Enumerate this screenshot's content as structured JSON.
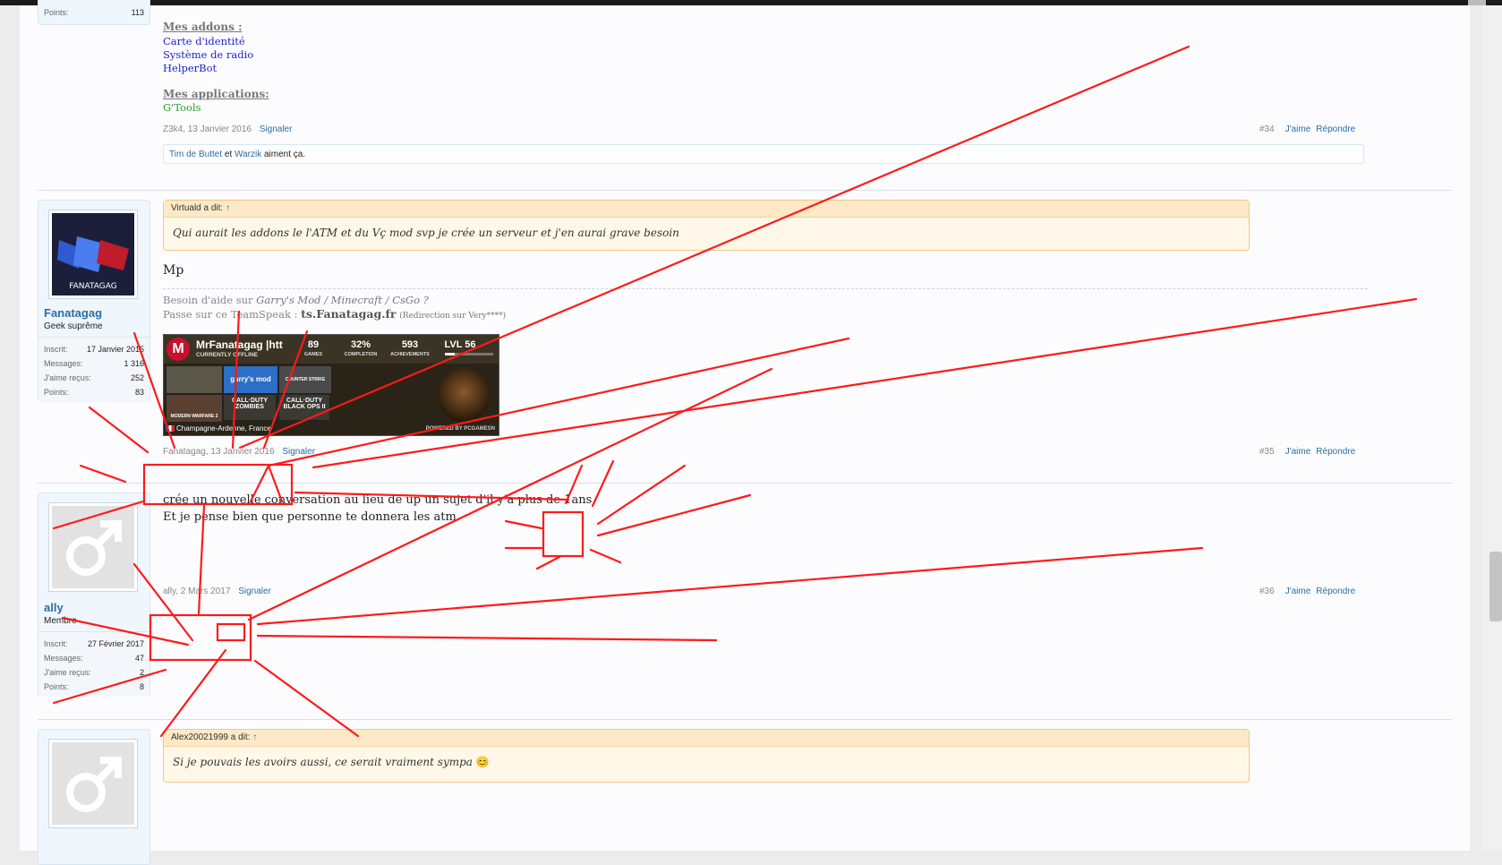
{
  "top_user": {
    "points_label": "Points:",
    "points": "113"
  },
  "post34": {
    "addons_heading": "Mes addons :",
    "addons": [
      "Carte d'identité",
      "Système de radio",
      "HelperBot"
    ],
    "apps_heading": "Mes applications:",
    "apps": [
      "G'Tools"
    ],
    "author": "Z3k4",
    "date": "13 Janvier 2016",
    "report": "Signaler",
    "number": "#34",
    "like": "J'aime",
    "reply": "Répondre",
    "likes": {
      "user1": "Tim de Buttet",
      "and": "et",
      "user2": "Warzik",
      "suffix": "aiment ça."
    }
  },
  "post35": {
    "user": {
      "avatar_text": "FANATAGAG",
      "name": "Fanatagag",
      "title": "Geek suprême",
      "stats": [
        {
          "label": "Inscrit:",
          "value": "17 Janvier 2015"
        },
        {
          "label": "Messages:",
          "value": "1 316"
        },
        {
          "label": "J'aime reçus:",
          "value": "252"
        },
        {
          "label": "Points:",
          "value": "83"
        }
      ]
    },
    "quote": {
      "author": "Virtuald a dit:",
      "arrow": "↑",
      "text": "Qui aurait les addons le l'ATM et du Vç mod svp je crée un serveur et j'en aurai grave besoin"
    },
    "message": "Mp",
    "signature": {
      "line1_prefix": "Besoin d'aide sur",
      "games": "Garry's Mod / Minecraft / CsGo ?",
      "line2_prefix": "Passe sur ce TeamSpeak :",
      "server": "ts.Fanatagag.fr",
      "note": "(Redirection sur Very****)"
    },
    "banner": {
      "logo": "M",
      "name": "MrFanatagag |htt",
      "status": "CURRENTLY OFFLINE",
      "stats": [
        {
          "n": "89",
          "l": "GAMES"
        },
        {
          "n": "32%",
          "l": "COMPLETION"
        },
        {
          "n": "593",
          "l": "ACHIEVEMENTS"
        },
        {
          "n": "LVL 56",
          "l": ""
        }
      ],
      "tiles": [
        "garry's mod",
        "COUNTER STRIKE",
        "CALL·DUTY ZOMBIES",
        "CALL·DUTY BLACK OPS II",
        "MODERN WARFARE 2"
      ],
      "location": "Champagne-Ardenne, France",
      "powered": "POWERED BY PCGAMESN"
    },
    "author": "Fanatagag",
    "date": "13 Janvier 2016",
    "report": "Signaler",
    "number": "#35",
    "like": "J'aime",
    "reply": "Répondre"
  },
  "post36": {
    "user": {
      "name": "ally",
      "title": "Membre",
      "stats": [
        {
          "label": "Inscrit:",
          "value": "27 Février 2017"
        },
        {
          "label": "Messages:",
          "value": "47"
        },
        {
          "label": "J'aime reçus:",
          "value": "2"
        },
        {
          "label": "Points:",
          "value": "8"
        }
      ]
    },
    "message_lines": [
      "crée un nouvelle conversation au lieu de up un sujet d'il y'a plus de 1ans",
      "Et je pense bien que personne te donnera les atm."
    ],
    "author": "ally",
    "date": "2 Mars 2017",
    "report": "Signaler",
    "number": "#36",
    "like": "J'aime",
    "reply": "Répondre"
  },
  "post37": {
    "quote": {
      "author": "Alex20021999 a dit:",
      "arrow": "↑",
      "text": "Si je pouvais les avoirs aussi, ce serait vraiment sympa",
      "emoji": "😊"
    }
  },
  "colors": {
    "link": "#2b6ea3",
    "annotation": "#ff0000",
    "quote_bg": "#fff8e8"
  }
}
